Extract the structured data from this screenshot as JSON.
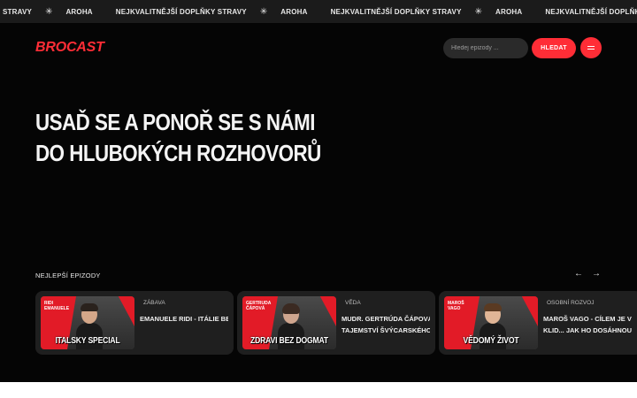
{
  "ticker": {
    "items": [
      "STRAVY",
      "AROHA",
      "NEJKVALITNĚJŠÍ DOPLŇKY STRAVY",
      "AROHA",
      "NEJKVALITNĚJŠÍ DOPLŇKY STRAVY",
      "AROHA",
      "NEJKVALITNĚJŠÍ DOPLŇKY STRAVY"
    ],
    "separator_icon": "sparkle-icon"
  },
  "header": {
    "logo": "BROCAST",
    "search_placeholder": "Hledej epizody ...",
    "search_button": "HLEDAT",
    "menu_icon": "hamburger-icon"
  },
  "hero": {
    "title_line1": "USAĎ SE A PONOŘ SE S NÁMI",
    "title_line2": "DO HLUBOKÝCH ROZHOVORŮ"
  },
  "episodes": {
    "section_label": "NEJLEPŠÍ EPIZODY",
    "prev_icon": "arrow-left-icon",
    "next_icon": "arrow-right-icon",
    "items": [
      {
        "guest": "RIDI EMANUELE",
        "thumb_caption": "ITALSKY SPECIAL",
        "category": "ZÁBAVA",
        "title_lines": [
          "EMANUELE RIDI - ITÁLIE BEZ FILTRU"
        ]
      },
      {
        "guest": "GERTRUDA ČÁPOVÁ",
        "thumb_caption": "ZDRAVI BEZ DOGMAT",
        "category": "VĚDA",
        "title_lines": [
          "MUDR. GERTRÚDA ČÁPOVÁ -",
          "TAJEMSTVÍ ŠVÝCARSKÉHO..."
        ]
      },
      {
        "guest": "MAROŠ VAGO",
        "thumb_caption": "VĚDOMÝ ŽIVOT",
        "category": "OSOBNÍ ROZVOJ",
        "title_lines": [
          "MAROŠ VAGO - CÍLEM JE VNITŘNÍ",
          "KLID... JAK HO DOSÁHNOUT?"
        ]
      }
    ]
  },
  "colors": {
    "accent": "#ff2d36",
    "background": "#050505",
    "card": "#1f1f1f",
    "ticker": "#1b1b1b"
  }
}
